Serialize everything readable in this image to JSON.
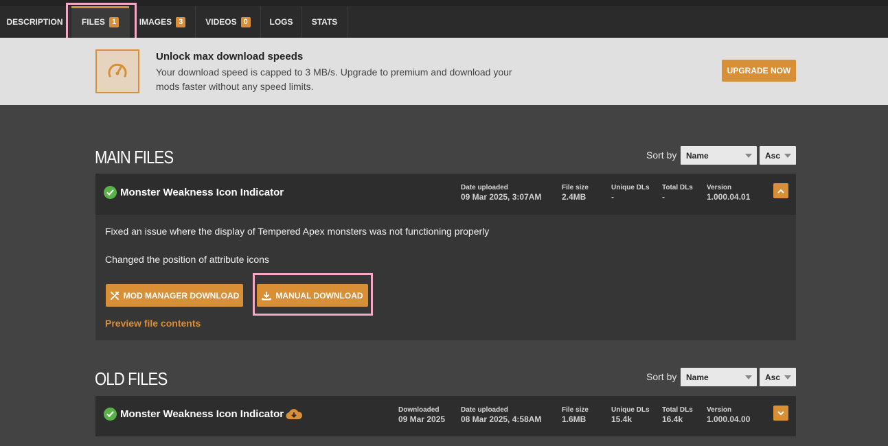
{
  "tabs": [
    {
      "label": "DESCRIPTION"
    },
    {
      "label": "FILES",
      "count": "1"
    },
    {
      "label": "IMAGES",
      "count": "3"
    },
    {
      "label": "VIDEOS",
      "count": "0"
    },
    {
      "label": "LOGS"
    },
    {
      "label": "STATS"
    }
  ],
  "banner": {
    "title": "Unlock max download speeds",
    "text": "Your download speed is capped to 3 MB/s. Upgrade to premium and download your mods faster without any speed limits.",
    "button": "UPGRADE NOW",
    "icon": "speedometer-icon"
  },
  "main_files": {
    "title": "MAIN FILES",
    "sort_label": "Sort by",
    "sort_field": "Name",
    "sort_order": "Asc",
    "file": {
      "name": "Monster Weakness Icon Indicator",
      "date_uploaded_label": "Date uploaded",
      "date_uploaded": "09 Mar 2025, 3:07AM",
      "file_size_label": "File size",
      "file_size": "2.4MB",
      "unique_dls_label": "Unique DLs",
      "unique_dls": "-",
      "total_dls_label": "Total DLs",
      "total_dls": "-",
      "version_label": "Version",
      "version": "1.000.04.01",
      "description_1": "Fixed an issue where the display of Tempered Apex monsters was not functioning properly",
      "description_2": "Changed the position of attribute icons",
      "mod_manager_button": "MOD MANAGER DOWNLOAD",
      "manual_button": "MANUAL DOWNLOAD",
      "preview_link": "Preview file contents"
    }
  },
  "old_files": {
    "title": "OLD FILES",
    "sort_label": "Sort by",
    "sort_field": "Name",
    "sort_order": "Asc",
    "file": {
      "name": "Monster Weakness Icon Indicator",
      "downloaded_label": "Downloaded",
      "downloaded": "09 Mar 2025",
      "date_uploaded_label": "Date uploaded",
      "date_uploaded": "08 Mar 2025, 4:58AM",
      "file_size_label": "File size",
      "file_size": "1.6MB",
      "unique_dls_label": "Unique DLs",
      "unique_dls": "15.4k",
      "total_dls_label": "Total DLs",
      "total_dls": "16.4k",
      "version_label": "Version",
      "version": "1.000.04.00"
    }
  },
  "colors": {
    "accent": "#d98f36",
    "success": "#57b346",
    "highlight": "#f2a9c5"
  }
}
